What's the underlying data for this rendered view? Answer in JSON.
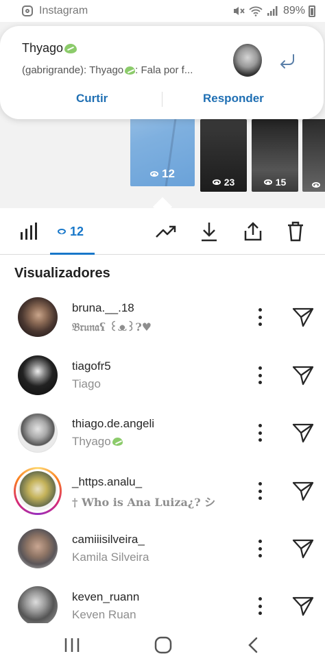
{
  "status_bar": {
    "app_name": "Instagram",
    "battery": "89%"
  },
  "notification": {
    "title": "Thyago",
    "text": "(gabrigrande): Thyago",
    "text_tail": ": Fala por f...",
    "like_label": "Curtir",
    "reply_label": "Responder"
  },
  "stories": [
    {
      "views": "12",
      "selected": true
    },
    {
      "views": "23"
    },
    {
      "views": "15"
    },
    {
      "views": ""
    }
  ],
  "toolbar": {
    "views_count": "12"
  },
  "viewers_section": {
    "title": "Visualizadores"
  },
  "viewers": [
    {
      "username": "bruna.__.18",
      "name": "𝔅𝔯𝔲𝔫𝔞ʕ ꒰ᴥ꒱?♥"
    },
    {
      "username": "tiagofr5",
      "name": "Tiago"
    },
    {
      "username": "thiago.de.angeli",
      "name": "Thyago"
    },
    {
      "username": "_https.analu_",
      "name": "† 𝐖𝐡𝐨 𝐢𝐬 𝐀𝐧𝐚 𝐋𝐮𝐢𝐳𝐚¿? シ"
    },
    {
      "username": "camiiisilveira_",
      "name": "Kamila Silveira"
    },
    {
      "username": "keven_ruann",
      "name": "Keven Ruan"
    }
  ],
  "colors": {
    "accent_blue": "#1877c9",
    "notif_button": "#1f6fb3",
    "secondary_text": "#8e8e8e"
  }
}
